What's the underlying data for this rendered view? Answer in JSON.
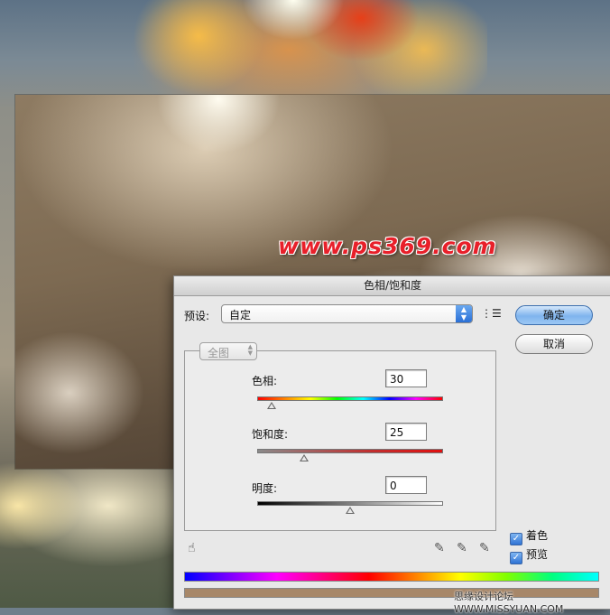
{
  "background": {
    "watermark": "www.ps369.com"
  },
  "dialog": {
    "title": "色相/饱和度",
    "preset_label": "预设:",
    "preset_value": "自定",
    "ok_label": "确定",
    "cancel_label": "取消",
    "channel_value": "全图",
    "hue": {
      "label": "色相:",
      "value": "30",
      "fraction": 0.08
    },
    "saturation": {
      "label": "饱和度:",
      "value": "25",
      "fraction": 0.25
    },
    "lightness": {
      "label": "明度:",
      "value": "0",
      "fraction": 0.5
    },
    "colorize": {
      "label": "着色",
      "checked": true
    },
    "preview": {
      "label": "预览",
      "checked": true
    },
    "result_color": "#a78769",
    "footer_credit": "思缘设计论坛 WWW.MISSYUAN.COM"
  }
}
